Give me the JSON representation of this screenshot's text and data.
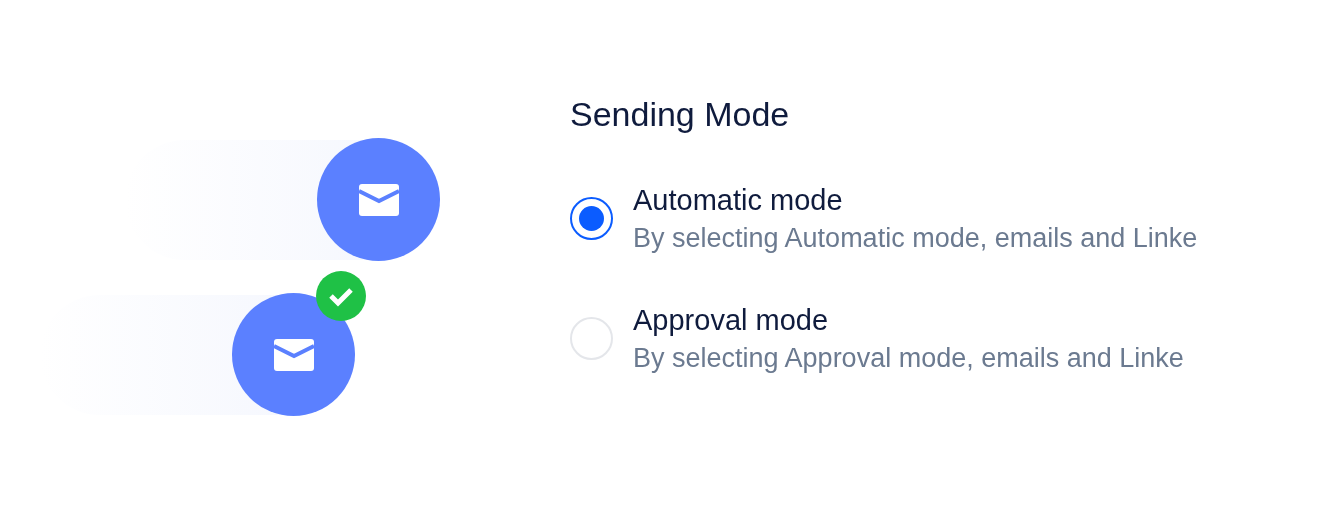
{
  "title": "Sending Mode",
  "options": [
    {
      "label": "Automatic mode",
      "description": "By selecting Automatic mode, emails and Linke",
      "selected": true
    },
    {
      "label": "Approval mode",
      "description": "By selecting Approval mode, emails and Linke",
      "selected": false
    }
  ]
}
